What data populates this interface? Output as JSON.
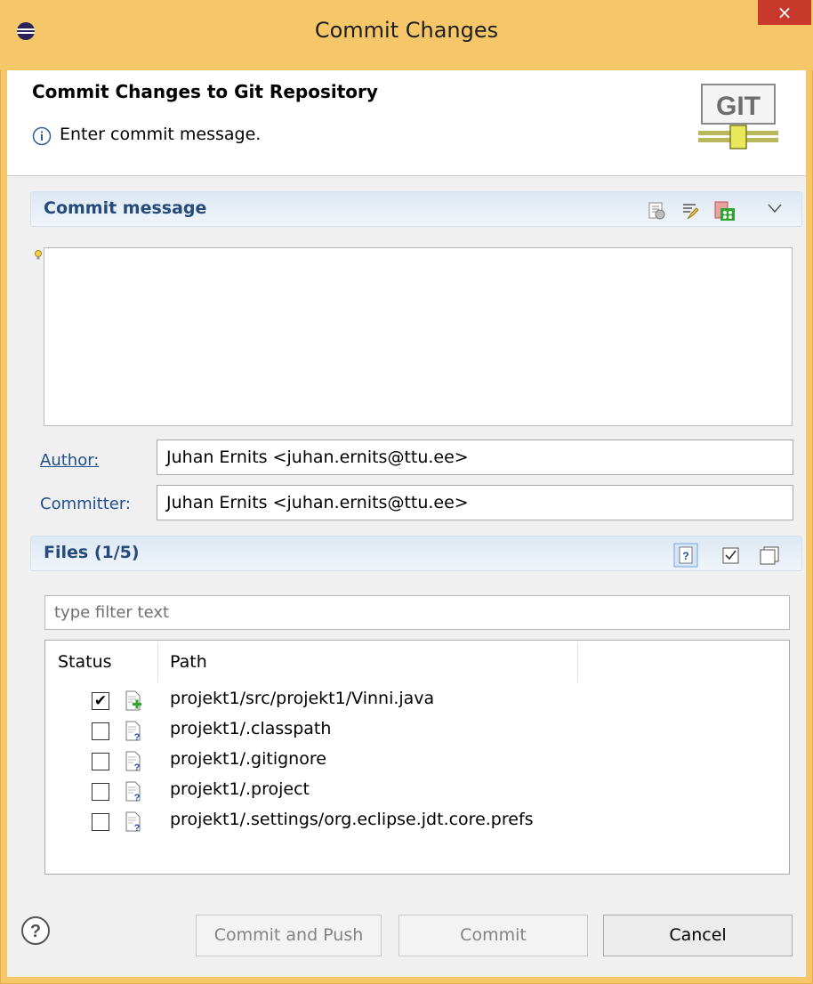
{
  "window": {
    "title": "Commit Changes",
    "close_glyph": "×"
  },
  "header": {
    "title": "Commit Changes to Git Repository",
    "info_message": "Enter commit message.",
    "logo_text": "GIT"
  },
  "commit_message": {
    "section_title": "Commit message",
    "value": ""
  },
  "author": {
    "label": "Author:",
    "value": "Juhan Ernits <juhan.ernits@ttu.ee>"
  },
  "committer": {
    "label": "Committer:",
    "value": "Juhan Ernits <juhan.ernits@ttu.ee>"
  },
  "files": {
    "section_title": "Files (1/5)",
    "filter_placeholder": "type filter text",
    "columns": [
      "Status",
      "Path"
    ],
    "rows": [
      {
        "checked": true,
        "icon": "added-file-icon",
        "path": "projekt1/src/projekt1/Vinni.java"
      },
      {
        "checked": false,
        "icon": "untracked-file-icon",
        "path": "projekt1/.classpath"
      },
      {
        "checked": false,
        "icon": "untracked-file-icon",
        "path": "projekt1/.gitignore"
      },
      {
        "checked": false,
        "icon": "untracked-file-icon",
        "path": "projekt1/.project"
      },
      {
        "checked": false,
        "icon": "untracked-file-icon",
        "path": "projekt1/.settings/org.eclipse.jdt.core.prefs"
      }
    ]
  },
  "buttons": {
    "commit_and_push": "Commit and Push",
    "commit": "Commit",
    "cancel": "Cancel"
  },
  "colors": {
    "titlebar": "#f5c769",
    "close": "#c7392b",
    "section_title": "#244b7a"
  }
}
